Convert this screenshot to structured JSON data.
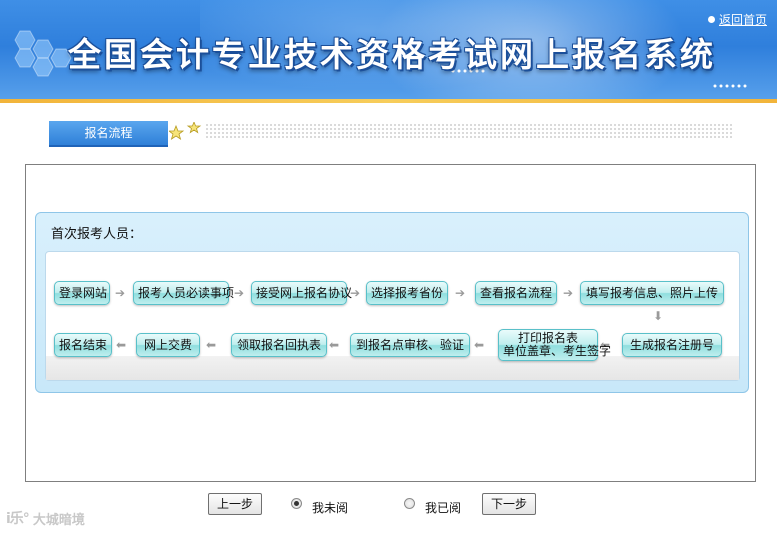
{
  "header": {
    "title": "全国会计专业技术资格考试网上报名系统",
    "home_link": "返回首页"
  },
  "section": {
    "tab_label": "报名流程"
  },
  "flow": {
    "label": "首次报考人员：",
    "row1": [
      "登录网站",
      "报考人员必读事项",
      "接受网上报名协议",
      "选择报考省份",
      "查看报名流程",
      "填写报考信息、照片上传"
    ],
    "row2": {
      "finish": "报名结束",
      "pay": "网上交费",
      "receipt": "领取报名回执表",
      "review": "到报名点审核、验证",
      "print_line1": "打印报名表",
      "print_line2": "单位盖章、考生签字",
      "register": "生成报名注册号"
    }
  },
  "controls": {
    "prev_label": "上一步",
    "next_label": "下一步",
    "unread_label": "我未阅",
    "read_label": "我已阅",
    "selected": "unread"
  },
  "watermark": {
    "logo": "i乐°",
    "text": "大城暗境"
  },
  "colors": {
    "banner_blue": "#2f7fdc",
    "accent_gold": "#f2b43a",
    "step_teal": "#8fdede",
    "panel_blue": "#c8e8f9"
  }
}
